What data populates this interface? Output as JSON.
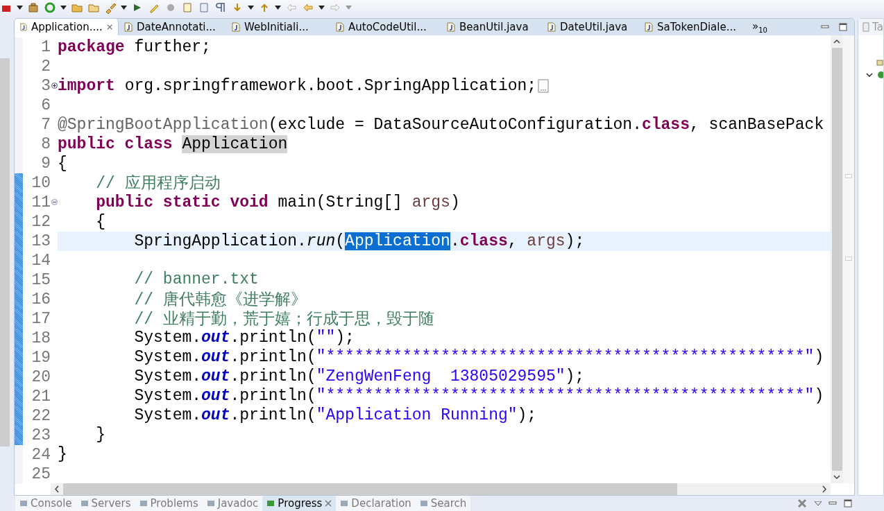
{
  "editor_tabs": [
    {
      "label": "Application....",
      "selected": true,
      "closable": true
    },
    {
      "label": "DateAnnotati...",
      "selected": false,
      "closable": false
    },
    {
      "label": "WebInitiali...",
      "selected": false,
      "closable": false
    },
    {
      "label": "AutoCodeUtil...",
      "selected": false,
      "closable": false
    },
    {
      "label": "BeanUtil.java",
      "selected": false,
      "closable": false
    },
    {
      "label": "DateUtil.java",
      "selected": false,
      "closable": false
    },
    {
      "label": "SaTokenDiale...",
      "selected": false,
      "closable": false
    }
  ],
  "overflow": {
    "chevron": "»",
    "count": "10"
  },
  "side_tab": {
    "label": "Ta"
  },
  "code_lines": [
    {
      "number": "1",
      "changed": false,
      "current": false,
      "foldable": false,
      "tokens": [
        {
          "kind": "keyword",
          "text": "package"
        },
        {
          "kind": "plain",
          "text": " further;"
        }
      ]
    },
    {
      "number": "2",
      "changed": false,
      "current": false,
      "foldable": false
    },
    {
      "number": "3",
      "changed": false,
      "current": false,
      "foldable": true,
      "collapsed": true,
      "tokens": [
        {
          "kind": "keyword",
          "text": "import"
        },
        {
          "kind": "plain",
          "text": " org.springframework.boot.SpringApplication;"
        }
      ]
    },
    {
      "number": "6",
      "changed": false,
      "current": false,
      "foldable": false
    },
    {
      "number": "7",
      "changed": false,
      "current": false,
      "foldable": false,
      "tokens": [
        {
          "kind": "annotation",
          "text": "@SpringBootApplication"
        },
        {
          "kind": "plain",
          "text": "(exclude = DataSourceAutoConfiguration."
        },
        {
          "kind": "keyword",
          "text": "class"
        },
        {
          "kind": "plain",
          "text": ", scanBasePack"
        }
      ]
    },
    {
      "number": "8",
      "changed": false,
      "current": false,
      "foldable": false,
      "tokens": [
        {
          "kind": "keyword",
          "text": "public class "
        },
        {
          "kind": "occurrence",
          "text": "Application"
        }
      ]
    },
    {
      "number": "9",
      "changed": false,
      "current": false,
      "foldable": false,
      "tokens": [
        {
          "kind": "plain",
          "text": "{"
        }
      ]
    },
    {
      "number": "10",
      "changed": true,
      "current": false,
      "foldable": false,
      "tokens": [
        {
          "kind": "comment",
          "text": "    // 应用程序启动"
        }
      ]
    },
    {
      "number": "11",
      "changed": true,
      "current": false,
      "foldable": true,
      "collapsed": false,
      "tokens": [
        {
          "kind": "keyword",
          "text": "    public static void"
        },
        {
          "kind": "plain",
          "text": " main(String[] "
        },
        {
          "kind": "param",
          "text": "args"
        },
        {
          "kind": "plain",
          "text": ")"
        }
      ]
    },
    {
      "number": "12",
      "changed": true,
      "current": false,
      "foldable": false,
      "tokens": [
        {
          "kind": "plain",
          "text": "    {"
        }
      ]
    },
    {
      "number": "13",
      "changed": true,
      "current": true,
      "foldable": false,
      "tokens": [
        {
          "kind": "plain",
          "text": "        SpringApplication."
        },
        {
          "kind": "static",
          "text": "run"
        },
        {
          "kind": "plain",
          "text": "("
        },
        {
          "kind": "selection",
          "text": "Application"
        },
        {
          "kind": "plain",
          "text": "."
        },
        {
          "kind": "keyword",
          "text": "class"
        },
        {
          "kind": "plain",
          "text": ", "
        },
        {
          "kind": "param",
          "text": "args"
        },
        {
          "kind": "plain",
          "text": ");"
        }
      ]
    },
    {
      "number": "14",
      "changed": true,
      "current": false,
      "foldable": false
    },
    {
      "number": "15",
      "changed": true,
      "current": false,
      "foldable": false,
      "tokens": [
        {
          "kind": "comment",
          "text": "        // banner.txt"
        }
      ]
    },
    {
      "number": "16",
      "changed": true,
      "current": false,
      "foldable": false,
      "tokens": [
        {
          "kind": "comment",
          "text": "        // 唐代韩愈《进学解》"
        }
      ]
    },
    {
      "number": "17",
      "changed": true,
      "current": false,
      "foldable": false,
      "tokens": [
        {
          "kind": "comment",
          "text": "        // 业精于勤，荒于嬉；行成于思，毁于随"
        }
      ]
    },
    {
      "number": "18",
      "changed": true,
      "current": false,
      "foldable": false,
      "tokens": [
        {
          "kind": "plain",
          "text": "        System."
        },
        {
          "kind": "field",
          "text": "out"
        },
        {
          "kind": "plain",
          "text": ".println("
        },
        {
          "kind": "string",
          "text": "\"\""
        },
        {
          "kind": "plain",
          "text": ");"
        }
      ]
    },
    {
      "number": "19",
      "changed": true,
      "current": false,
      "foldable": false,
      "tokens": [
        {
          "kind": "plain",
          "text": "        System."
        },
        {
          "kind": "field",
          "text": "out"
        },
        {
          "kind": "plain",
          "text": ".println("
        },
        {
          "kind": "string",
          "text": "\"**************************************************\""
        },
        {
          "kind": "plain",
          "text": ")"
        }
      ]
    },
    {
      "number": "20",
      "changed": true,
      "current": false,
      "foldable": false,
      "tokens": [
        {
          "kind": "plain",
          "text": "        System."
        },
        {
          "kind": "field",
          "text": "out"
        },
        {
          "kind": "plain",
          "text": ".println("
        },
        {
          "kind": "string",
          "text": "\"ZengWenFeng  13805029595\""
        },
        {
          "kind": "plain",
          "text": ");"
        }
      ]
    },
    {
      "number": "21",
      "changed": true,
      "current": false,
      "foldable": false,
      "tokens": [
        {
          "kind": "plain",
          "text": "        System."
        },
        {
          "kind": "field",
          "text": "out"
        },
        {
          "kind": "plain",
          "text": ".println("
        },
        {
          "kind": "string",
          "text": "\"**************************************************\""
        },
        {
          "kind": "plain",
          "text": ")"
        }
      ]
    },
    {
      "number": "22",
      "changed": true,
      "current": false,
      "foldable": false,
      "tokens": [
        {
          "kind": "plain",
          "text": "        System."
        },
        {
          "kind": "field",
          "text": "out"
        },
        {
          "kind": "plain",
          "text": ".println("
        },
        {
          "kind": "string",
          "text": "\"Application Running\""
        },
        {
          "kind": "plain",
          "text": ");"
        }
      ]
    },
    {
      "number": "23",
      "changed": true,
      "current": false,
      "foldable": false,
      "tokens": [
        {
          "kind": "plain",
          "text": "    }"
        }
      ]
    },
    {
      "number": "24",
      "changed": false,
      "current": false,
      "foldable": false,
      "tokens": [
        {
          "kind": "plain",
          "text": "}"
        }
      ]
    },
    {
      "number": "25",
      "changed": false,
      "current": false,
      "foldable": false
    }
  ],
  "bottom_tabs": [
    {
      "label": "Console",
      "selected": false,
      "closable": false
    },
    {
      "label": "Servers",
      "selected": false,
      "closable": false
    },
    {
      "label": "Problems",
      "selected": false,
      "closable": false
    },
    {
      "label": "Javadoc",
      "selected": false,
      "closable": false
    },
    {
      "label": "Progress",
      "selected": true,
      "closable": true
    },
    {
      "label": "Declaration",
      "selected": false,
      "closable": false
    },
    {
      "label": "Search",
      "selected": false,
      "closable": false
    }
  ]
}
